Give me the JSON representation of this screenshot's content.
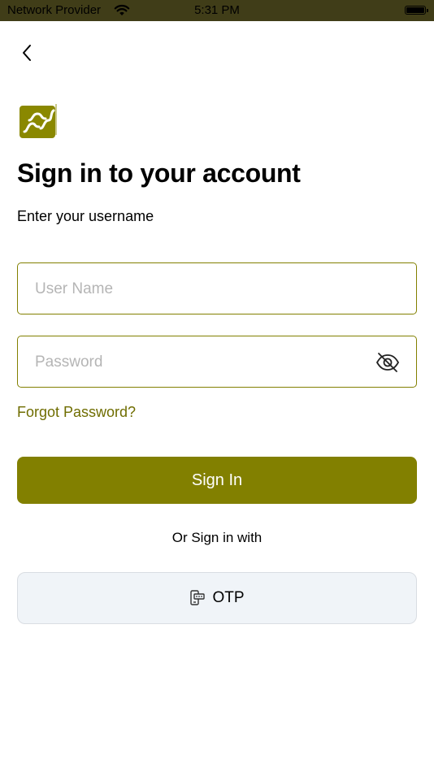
{
  "status_bar": {
    "carrier": "Network Provider",
    "time": "5:31 PM"
  },
  "header": {
    "back_icon": "chevron-left-icon"
  },
  "logo": {
    "icon": "brand-logo"
  },
  "title": "Sign in to your account",
  "subtitle": "Enter your username",
  "form": {
    "username_placeholder": "User Name",
    "username_value": "",
    "password_placeholder": "Password",
    "password_value": "",
    "password_toggle_icon": "eye-slash-icon"
  },
  "forgot_password": "Forgot Password?",
  "sign_in_label": "Sign In",
  "or_text": "Or Sign in with",
  "otp_label": "OTP",
  "colors": {
    "accent": "#828000",
    "status_bar": "#403d18",
    "link": "#6f6d00",
    "otp_bg": "#f0f4f8"
  }
}
